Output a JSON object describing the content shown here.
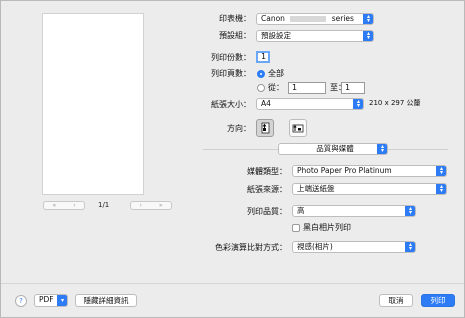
{
  "printer": {
    "label": "印表機：",
    "value": "Canon",
    "value_suffix": "series"
  },
  "presets": {
    "label": "預設組：",
    "value": "預設設定"
  },
  "copies": {
    "label": "列印份數：",
    "value": "1"
  },
  "pages": {
    "label": "列印頁數：",
    "all_label": "全部",
    "from_label": "從：",
    "from_value": "1",
    "to_label": "至：",
    "to_value": "1"
  },
  "paper_size": {
    "label": "紙張大小：",
    "value": "A4",
    "dimensions": "210 x 297 公釐"
  },
  "orientation": {
    "label": "方向：",
    "selected": "portrait"
  },
  "section_menu": {
    "value": "品質與媒體"
  },
  "media_type": {
    "label": "媒體類型：",
    "value": "Photo Paper Pro Platinum"
  },
  "paper_source": {
    "label": "紙張來源：",
    "value": "上端送紙盤"
  },
  "print_quality": {
    "label": "列印品質：",
    "value": "高"
  },
  "grayscale": {
    "label": "黑白相片列印",
    "checked": false
  },
  "color_matching": {
    "label": "色彩演算比對方式：",
    "value": "視感(相片)"
  },
  "preview": {
    "page_indicator": "1/1",
    "first_glyph": "«",
    "prev_glyph": "‹",
    "next_glyph": "›",
    "last_glyph": "»"
  },
  "footer": {
    "help_glyph": "?",
    "pdf_label": "PDF",
    "hide_details_label": "隱藏詳細資訊",
    "cancel_label": "取消",
    "print_label": "列印"
  },
  "colors": {
    "accent": "#2d7cf6",
    "background": "#ececec"
  }
}
